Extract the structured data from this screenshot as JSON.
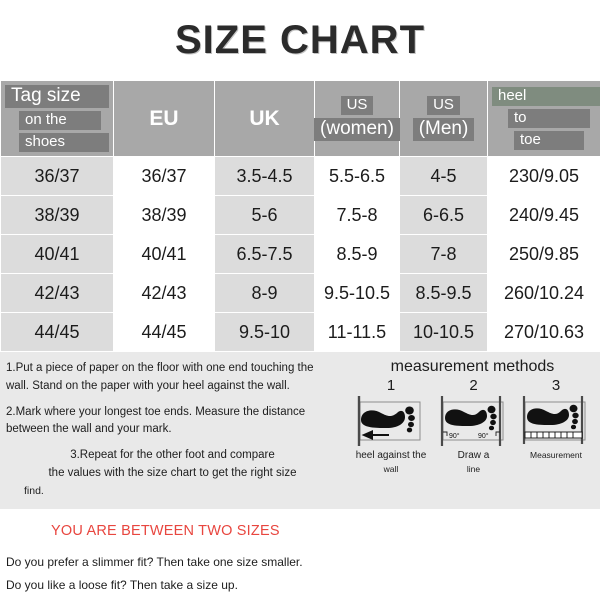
{
  "title": "SIZE CHART",
  "table": {
    "headers": [
      {
        "type": "stack",
        "lines": [
          "Tag size",
          "on the",
          "shoes"
        ],
        "style": "left-highlight"
      },
      {
        "type": "plain",
        "label": "EU"
      },
      {
        "type": "plain",
        "label": "UK"
      },
      {
        "type": "stack",
        "lines": [
          "US",
          "(women)"
        ],
        "style": "center-highlight"
      },
      {
        "type": "stack",
        "lines": [
          "US",
          "(Men)"
        ],
        "style": "center-highlight"
      },
      {
        "type": "stack",
        "lines": [
          "heel",
          "to",
          "toe"
        ],
        "style": "green-highlight"
      }
    ],
    "rows": [
      [
        "36/37",
        "36/37",
        "3.5-4.5",
        "5.5-6.5",
        "4-5",
        "230/9.05"
      ],
      [
        "38/39",
        "38/39",
        "5-6",
        "7.5-8",
        "6-6.5",
        "240/9.45"
      ],
      [
        "40/41",
        "40/41",
        "6.5-7.5",
        "8.5-9",
        "7-8",
        "250/9.85"
      ],
      [
        "42/43",
        "42/43",
        "8-9",
        "9.5-10.5",
        "8.5-9.5",
        "260/10.24"
      ],
      [
        "44/45",
        "44/45",
        "9.5-10",
        "11-11.5",
        "10-10.5",
        "270/10.63"
      ]
    ]
  },
  "instructions": {
    "step1": "1.Put a piece of paper on the floor with one end touching the wall. Stand on the paper with your heel against the wall.",
    "step2": "2.Mark where your longest toe ends. Measure the distance between the wall and your mark.",
    "step3_line1": "3.Repeat for the other foot and compare",
    "step3_line2": "the values with the size chart to get the right size",
    "step3_line3": "find."
  },
  "measurement": {
    "title": "measurement methods",
    "diagrams": [
      {
        "number": "1",
        "caption_line1": "heel against the",
        "caption_line2": "wall"
      },
      {
        "number": "2",
        "caption_line1": "Draw a",
        "caption_line2": "line",
        "angle_left": "90°",
        "angle_right": "90°"
      },
      {
        "number": "3",
        "caption_line1": "Measurement",
        "caption_line2": ""
      }
    ]
  },
  "bottom": {
    "between_sizes": "YOU ARE BETWEEN TWO SIZES",
    "q1": "Do you prefer a slimmer fit? Then take one size smaller.",
    "q2": "Do you like a loose fit? Then take a size up."
  },
  "colors": {
    "header_bg": "#a8a8a8",
    "highlight": "#7d7d7d",
    "highlight_green": "#7f8c7f",
    "row_shade": "#dcdcdc",
    "panel_bg": "#e9e9e9",
    "accent_red": "#e8463f"
  }
}
